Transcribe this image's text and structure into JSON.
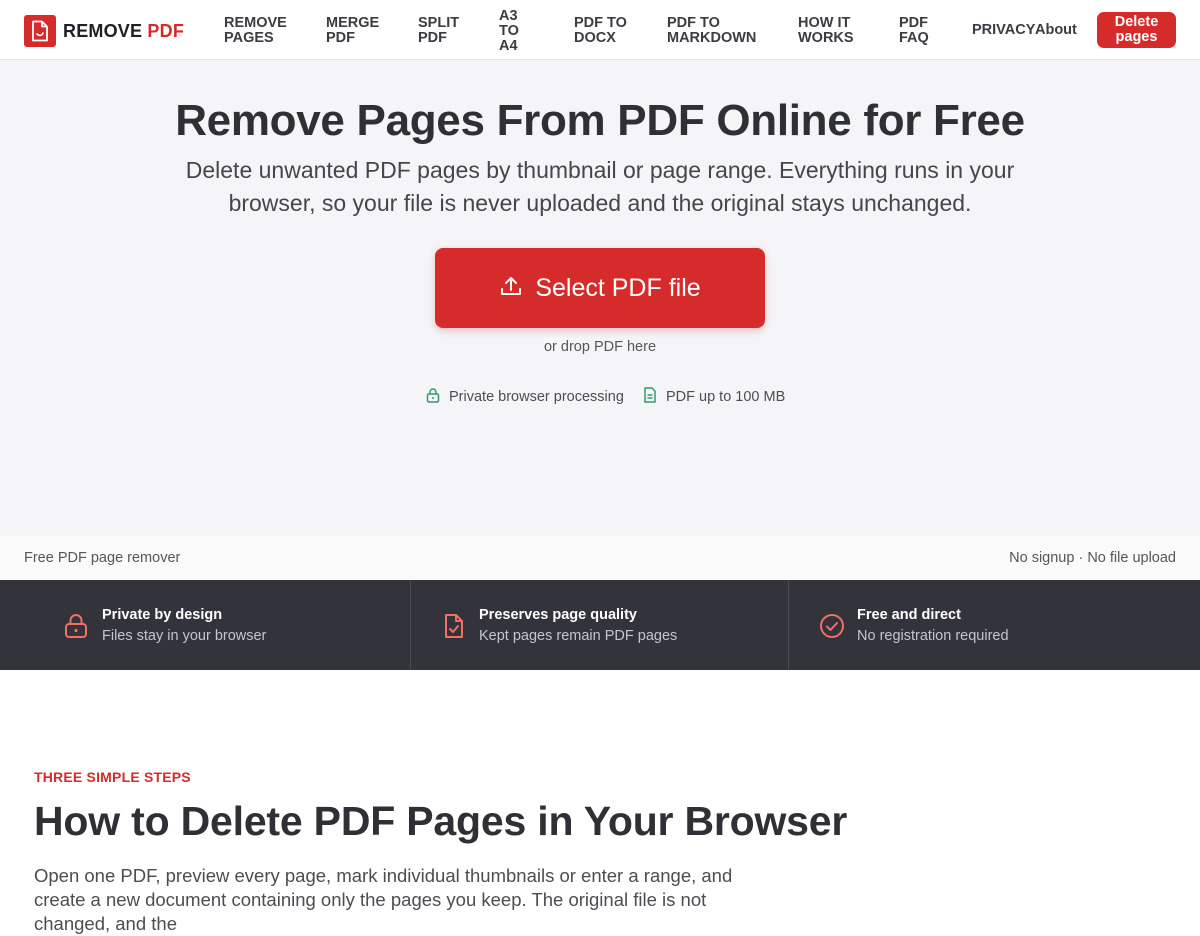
{
  "brand": {
    "name_part1": "REMOVE",
    "name_part2": "PDF",
    "accent_color": "#d62b2b",
    "icon": "pdf-file-icon"
  },
  "nav": {
    "items": [
      {
        "label": "REMOVE PAGES"
      },
      {
        "label": "MERGE PDF"
      },
      {
        "label": "SPLIT PDF"
      },
      {
        "label": "A3 TO A4"
      },
      {
        "label": "PDF TO DOCX"
      },
      {
        "label": "PDF TO MARKDOWN"
      },
      {
        "label": "HOW IT WORKS"
      },
      {
        "label": "PDF FAQ"
      },
      {
        "label": "PRIVACY"
      },
      {
        "label": "About"
      }
    ],
    "cta_label": "Delete pages"
  },
  "hero": {
    "title": "Remove Pages From PDF Online for Free",
    "subtitle": "Delete unwanted PDF pages by thumbnail or page range. Everything runs in your browser, so your file is never uploaded and the original stays unchanged.",
    "upload_button": "Select PDF file",
    "upload_icon": "upload-icon",
    "drop_hint": "or drop PDF here",
    "trust": [
      {
        "icon": "lock-icon",
        "label": "Private browser processing"
      },
      {
        "icon": "document-icon",
        "label": "PDF up to 100 MB"
      }
    ]
  },
  "strip": {
    "left": "Free PDF page remover",
    "right": "No signup · No file upload"
  },
  "features": [
    {
      "icon": "lock-icon",
      "title": "Private by design",
      "desc": "Files stay in your browser"
    },
    {
      "icon": "file-check-icon",
      "title": "Preserves page quality",
      "desc": "Kept pages remain PDF pages"
    },
    {
      "icon": "check-circle-icon",
      "title": "Free and direct",
      "desc": "No registration required"
    }
  ],
  "steps": {
    "eyebrow": "THREE SIMPLE STEPS",
    "title": "How to Delete PDF Pages in Your Browser",
    "body": "Open one PDF, preview every page, mark individual thumbnails or enter a range, and create a new document containing only the pages you keep. The original file is not changed, and the"
  }
}
